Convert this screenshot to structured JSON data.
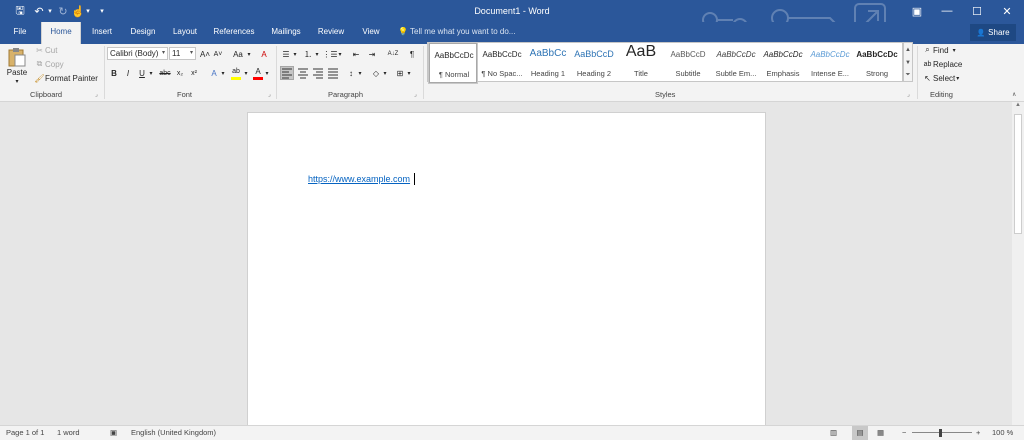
{
  "window": {
    "title": "Document1 - Word",
    "controls": {
      "ribbon_display": "▣",
      "minimize": "—",
      "maximize": "☐",
      "close": "✕"
    }
  },
  "quick_access": {
    "save": "🖫",
    "undo": "↶",
    "undo_arrow": "▾",
    "redo": "↻",
    "touch": "☝",
    "touch_arrow": "▾",
    "customize": "▾"
  },
  "tabs": [
    {
      "label": "File"
    },
    {
      "label": "Home"
    },
    {
      "label": "Insert"
    },
    {
      "label": "Design"
    },
    {
      "label": "Layout"
    },
    {
      "label": "References"
    },
    {
      "label": "Mailings"
    },
    {
      "label": "Review"
    },
    {
      "label": "View"
    }
  ],
  "tell_me": {
    "icon": "💡",
    "text": "Tell me what you want to do..."
  },
  "share": {
    "icon": "👤",
    "label": "Share"
  },
  "clipboard": {
    "paste_label": "Paste",
    "paste_arrow": "▾",
    "cut_label": "Cut",
    "copy_label": "Copy",
    "format_painter_label": "Format Painter",
    "group_label": "Clipboard"
  },
  "font": {
    "name": "Calibri (Body)",
    "size": "11",
    "group_label": "Font",
    "grow": "A˄",
    "shrink": "A˅",
    "change_case": "Aa",
    "clear": "A",
    "bold": "B",
    "italic": "I",
    "underline": "U",
    "strike": "abc",
    "subscript": "x₂",
    "superscript": "x²",
    "text_effects": "A",
    "highlight": "ab",
    "font_color": "A",
    "highlight_color": "#ffff00",
    "font_color_bar": "#ff0000"
  },
  "paragraph": {
    "group_label": "Paragraph",
    "bullets": "☰",
    "numbering": "⒈",
    "multilevel": "⋮☰",
    "decrease_indent": "⇤",
    "increase_indent": "⇥",
    "sort": "A↓Z",
    "show_marks": "¶",
    "line_spacing": "↕",
    "shading": "◇",
    "borders": "⊞"
  },
  "styles": {
    "group_label": "Styles",
    "items": [
      {
        "preview": "AaBbCcDc",
        "name": "¶ Normal"
      },
      {
        "preview": "AaBbCcDc",
        "name": "¶ No Spac..."
      },
      {
        "preview": "AaBbCc",
        "name": "Heading 1"
      },
      {
        "preview": "AaBbCcD",
        "name": "Heading 2"
      },
      {
        "preview": "AaB",
        "name": "Title"
      },
      {
        "preview": "AaBbCcD",
        "name": "Subtitle"
      },
      {
        "preview": "AaBbCcDc",
        "name": "Subtle Em..."
      },
      {
        "preview": "AaBbCcDc",
        "name": "Emphasis"
      },
      {
        "preview": "AaBbCcDc",
        "name": "Intense E..."
      },
      {
        "preview": "AaBbCcDc",
        "name": "Strong"
      }
    ]
  },
  "editing": {
    "group_label": "Editing",
    "find_label": "Find",
    "replace_label": "Replace",
    "select_label": "Select"
  },
  "document": {
    "text": "https://www.example.com"
  },
  "status": {
    "page": "Page 1 of 1",
    "words": "1 word",
    "language": "English (United Kingdom)",
    "zoom_out": "−",
    "zoom_in": "+",
    "zoom": "100 %"
  },
  "colors": {
    "brand": "#2b579a",
    "link": "#0563c1"
  }
}
